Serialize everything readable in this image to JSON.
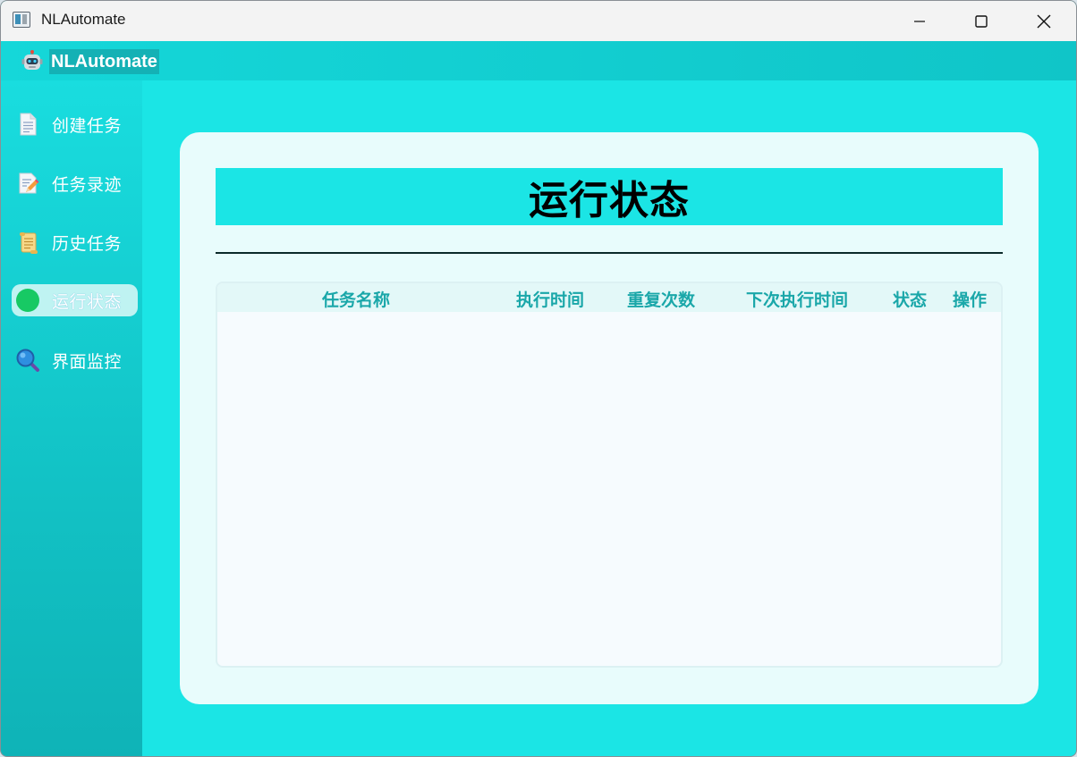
{
  "window": {
    "title": "NLAutomate"
  },
  "header": {
    "brand": "NLAutomate"
  },
  "sidebar": {
    "items": [
      {
        "label": "创建任务",
        "icon": "document-icon",
        "active": false
      },
      {
        "label": "任务录迹",
        "icon": "pencil-memo-icon",
        "active": false
      },
      {
        "label": "历史任务",
        "icon": "scroll-icon",
        "active": false
      },
      {
        "label": "运行状态",
        "icon": "green-circle-icon",
        "active": true
      },
      {
        "label": "界面监控",
        "icon": "magnifier-icon",
        "active": false
      }
    ]
  },
  "main": {
    "title": "运行状态",
    "table": {
      "columns": [
        "任务名称",
        "执行时间",
        "重复次数",
        "下次执行时间",
        "状态",
        "操作"
      ],
      "rows": []
    }
  },
  "colors": {
    "accent": "#1be5e5",
    "sidebar": "#12c2c5",
    "card": "#e8fcfc",
    "header_text": "#1aa7a9",
    "active_item": "#bff3f2"
  }
}
